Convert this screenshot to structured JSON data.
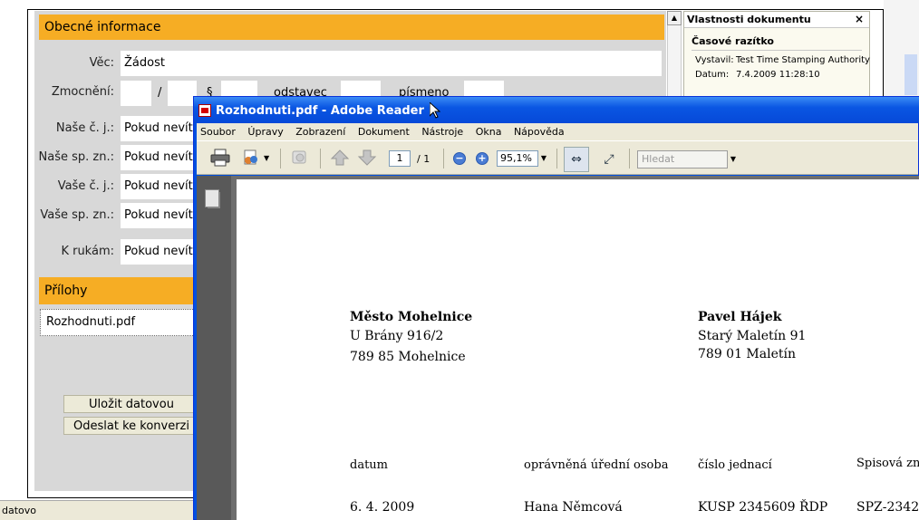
{
  "form": {
    "section_general": "Obecné informace",
    "vec_label": "Věc:",
    "vec_value": "Žádost",
    "zmocneni_label": "Zmocnění:",
    "slash": "/",
    "paragraf_fragment": "§",
    "odstavec_label": "odstavec",
    "pismeno_label": "písmeno",
    "nase_cj_label": "Naše č. j.:",
    "nase_cj_value": "Pokud nevíte",
    "nase_spzn_label": "Naše sp. zn.:",
    "nase_spzn_value": "Pokud nevíte",
    "vase_cj_label": "Vaše č. j.:",
    "vase_cj_value": "Pokud nevíte",
    "vase_spzn_label": "Vaše sp. zn.:",
    "vase_spzn_value": "Pokud nevíte",
    "k_rukam_label": "K rukám:",
    "k_rukam_value": "Pokud nevíte",
    "section_attachments": "Přílohy",
    "attachment_name": "Rozhodnuti.pdf",
    "save_button": "Uložit datovou",
    "send_button": "Odeslat ke konverzi"
  },
  "properties": {
    "title": "Vlastnosti dokumentu",
    "close": "×",
    "subtitle": "Časové razítko",
    "issuer_key": "Vystavil:",
    "issuer_value": "Test Time Stamping Authority",
    "date_key": "Datum:",
    "date_value": "7.4.2009 11:28:10"
  },
  "status_bar": {
    "text": "datovo"
  },
  "reader": {
    "title": "Rozhodnuti.pdf - Adobe Reader",
    "menu": [
      "Soubor",
      "Úpravy",
      "Zobrazení",
      "Dokument",
      "Nástroje",
      "Okna",
      "Nápověda"
    ],
    "page_current": "1",
    "page_total": "/ 1",
    "zoom": "95,1%",
    "search_placeholder": "Hledat"
  },
  "document": {
    "sender_name": "Město Mohelnice",
    "sender_street": "U Brány 916/2",
    "sender_city": "789 85 Mohelnice",
    "recipient_name": "Pavel Hájek",
    "recipient_street": "Starý Maletín 91",
    "recipient_city": "789 01 Maletín",
    "headers": [
      "datum",
      "oprávněná úřední osoba",
      "číslo jednací",
      "Spisová zn"
    ],
    "values": [
      "6. 4. 2009",
      "Hana Němcová",
      "KUSP 2345609 ŘDP",
      "SPZ-2342"
    ]
  }
}
